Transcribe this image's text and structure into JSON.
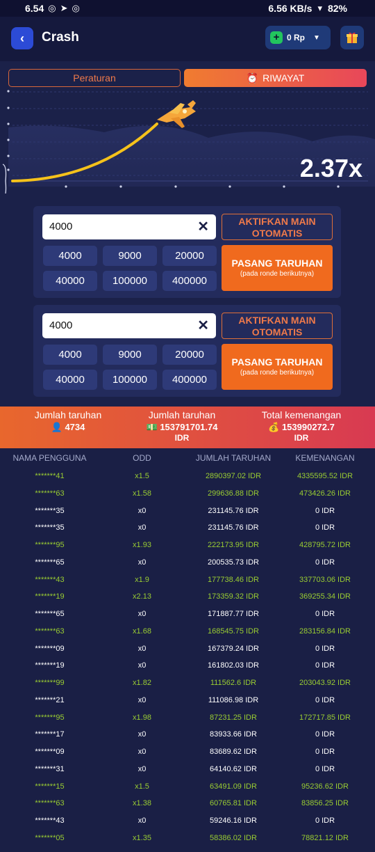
{
  "status_bar": {
    "time": "6.54",
    "speed": "6.56 KB/s",
    "battery": "82%"
  },
  "header": {
    "title": "Crash",
    "balance": "0 Rp"
  },
  "tabs": {
    "rules": "Peraturan",
    "history": "RIWAYAT"
  },
  "game": {
    "multiplier": "2.37x"
  },
  "bet_panels": [
    {
      "amount": "4000",
      "chips": [
        "4000",
        "9000",
        "20000",
        "40000",
        "100000",
        "400000"
      ],
      "auto_label": "AKTIFKAN MAIN OTOMATIS",
      "bet_label": "PASANG TARUHAN",
      "bet_sub": "(pada ronde berikutnya)"
    },
    {
      "amount": "4000",
      "chips": [
        "4000",
        "9000",
        "20000",
        "40000",
        "100000",
        "400000"
      ],
      "auto_label": "AKTIFKAN MAIN OTOMATIS",
      "bet_label": "PASANG TARUHAN",
      "bet_sub": "(pada ronde berikutnya)"
    }
  ],
  "summary": {
    "count_label": "Jumlah taruhan",
    "count_value": "4734",
    "amount_label": "Jumlah taruhan",
    "amount_value": "153791701.74",
    "amount_unit": "IDR",
    "total_label": "Total kemenangan",
    "total_value": "153990272.7",
    "total_unit": "IDR"
  },
  "table": {
    "headers": [
      "NAMA PENGGUNA",
      "ODD",
      "JUMLAH TARUHAN",
      "KEMENANGAN"
    ],
    "rows": [
      {
        "user": "*******41",
        "odd": "x1.5",
        "bet": "2890397.02 IDR",
        "win": "4335595.52 IDR",
        "won": true
      },
      {
        "user": "*******63",
        "odd": "x1.58",
        "bet": "299636.88 IDR",
        "win": "473426.26 IDR",
        "won": true
      },
      {
        "user": "*******35",
        "odd": "x0",
        "bet": "231145.76 IDR",
        "win": "0 IDR",
        "won": false
      },
      {
        "user": "*******35",
        "odd": "x0",
        "bet": "231145.76 IDR",
        "win": "0 IDR",
        "won": false
      },
      {
        "user": "*******95",
        "odd": "x1.93",
        "bet": "222173.95 IDR",
        "win": "428795.72 IDR",
        "won": true
      },
      {
        "user": "*******65",
        "odd": "x0",
        "bet": "200535.73 IDR",
        "win": "0 IDR",
        "won": false
      },
      {
        "user": "*******43",
        "odd": "x1.9",
        "bet": "177738.46 IDR",
        "win": "337703.06 IDR",
        "won": true
      },
      {
        "user": "*******19",
        "odd": "x2.13",
        "bet": "173359.32 IDR",
        "win": "369255.34 IDR",
        "won": true
      },
      {
        "user": "*******65",
        "odd": "x0",
        "bet": "171887.77 IDR",
        "win": "0 IDR",
        "won": false
      },
      {
        "user": "*******63",
        "odd": "x1.68",
        "bet": "168545.75 IDR",
        "win": "283156.84 IDR",
        "won": true
      },
      {
        "user": "*******09",
        "odd": "x0",
        "bet": "167379.24 IDR",
        "win": "0 IDR",
        "won": false
      },
      {
        "user": "*******19",
        "odd": "x0",
        "bet": "161802.03 IDR",
        "win": "0 IDR",
        "won": false
      },
      {
        "user": "*******99",
        "odd": "x1.82",
        "bet": "111562.6 IDR",
        "win": "203043.92 IDR",
        "won": true
      },
      {
        "user": "*******21",
        "odd": "x0",
        "bet": "111086.98 IDR",
        "win": "0 IDR",
        "won": false
      },
      {
        "user": "*******95",
        "odd": "x1.98",
        "bet": "87231.25 IDR",
        "win": "172717.85 IDR",
        "won": true
      },
      {
        "user": "*******17",
        "odd": "x0",
        "bet": "83933.66 IDR",
        "win": "0 IDR",
        "won": false
      },
      {
        "user": "*******09",
        "odd": "x0",
        "bet": "83689.62 IDR",
        "win": "0 IDR",
        "won": false
      },
      {
        "user": "*******31",
        "odd": "x0",
        "bet": "64140.62 IDR",
        "win": "0 IDR",
        "won": false
      },
      {
        "user": "*******15",
        "odd": "x1.5",
        "bet": "63491.09 IDR",
        "win": "95236.62 IDR",
        "won": true
      },
      {
        "user": "*******63",
        "odd": "x1.38",
        "bet": "60765.81 IDR",
        "win": "83856.25 IDR",
        "won": true
      },
      {
        "user": "*******43",
        "odd": "x0",
        "bet": "59246.16 IDR",
        "win": "0 IDR",
        "won": false
      },
      {
        "user": "*******05",
        "odd": "x1.35",
        "bet": "58386.02 IDR",
        "win": "78821.12 IDR",
        "won": true
      }
    ]
  }
}
